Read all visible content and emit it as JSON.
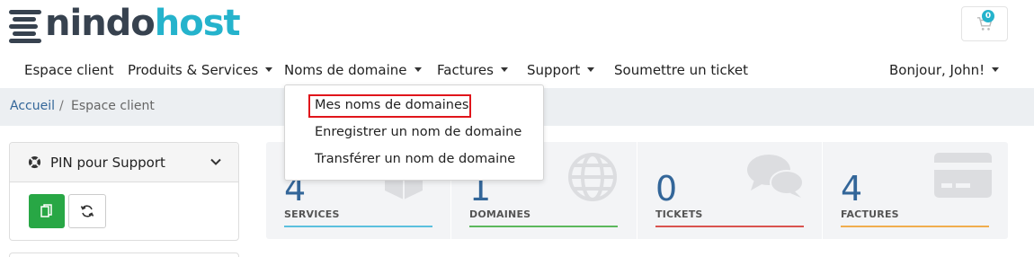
{
  "brand": {
    "part1": "nindo",
    "part2": "host",
    "dark_color": "#37424f",
    "accent_color": "#25b3cc"
  },
  "cart": {
    "icon": "cart-icon",
    "count": "0"
  },
  "nav": {
    "items": [
      {
        "label": "Espace client"
      },
      {
        "label": "Produits & Services"
      },
      {
        "label": "Noms de domaine"
      },
      {
        "label": "Factures"
      },
      {
        "label": "Support"
      },
      {
        "label": "Soumettre un ticket"
      }
    ],
    "user_greeting": "Bonjour, John!"
  },
  "breadcrumb": {
    "home": "Accueil",
    "separator": "/",
    "current": "Espace client"
  },
  "pin_panel": {
    "title": "PIN pour Support",
    "title_icon": "lifebuoy-icon",
    "copy_icon": "copy-icon",
    "refresh_icon": "refresh-icon",
    "copy_color": "#28a745"
  },
  "stats": [
    {
      "value": "4",
      "label": "SERVICES",
      "icon": "cube-icon",
      "color": "#5bc0de"
    },
    {
      "value": "1",
      "label": "DOMAINES",
      "icon": "globe-icon",
      "color": "#5cb85c"
    },
    {
      "value": "0",
      "label": "TICKETS",
      "icon": "comments-icon",
      "color": "#d9534f"
    },
    {
      "value": "4",
      "label": "FACTURES",
      "icon": "credit-card-icon",
      "color": "#f0ad4e"
    }
  ],
  "dropdown": {
    "items": [
      {
        "label": "Mes noms de domaines",
        "highlighted": true
      },
      {
        "label": "Enregistrer un nom de domaine"
      },
      {
        "label": "Transférer un nom de domaine"
      }
    ],
    "highlight_color": "#e0151b"
  }
}
